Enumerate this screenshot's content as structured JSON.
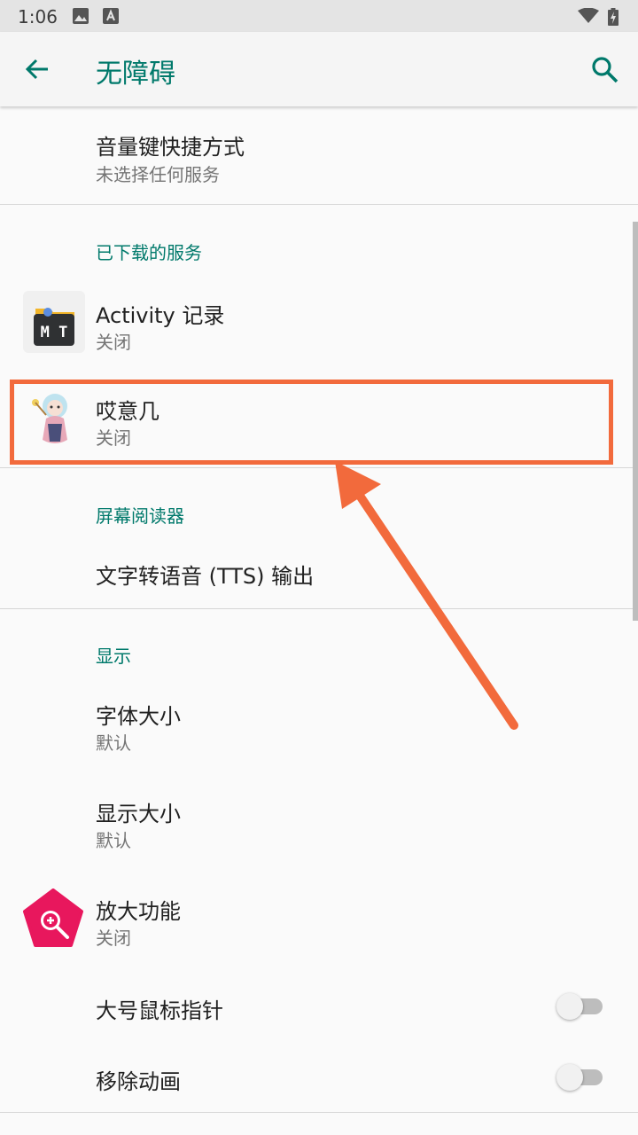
{
  "status_bar": {
    "time": "1:06"
  },
  "app_bar": {
    "title": "无障碍"
  },
  "shortcut": {
    "title": "音量键快捷方式",
    "summary": "未选择任何服务"
  },
  "downloaded_services": {
    "header": "已下载的服务",
    "items": [
      {
        "title": "Activity 记录",
        "summary": "关闭",
        "icon": "mt-manager-icon"
      },
      {
        "title": "哎意几",
        "summary": "关闭",
        "icon": "anime-character-icon"
      }
    ]
  },
  "screen_reader": {
    "header": "屏幕阅读器",
    "tts_title": "文字转语音 (TTS) 输出"
  },
  "display": {
    "header": "显示",
    "font_size": {
      "title": "字体大小",
      "summary": "默认"
    },
    "display_size": {
      "title": "显示大小",
      "summary": "默认"
    },
    "magnification": {
      "title": "放大功能",
      "summary": "关闭"
    },
    "large_pointer": {
      "title": "大号鼠标指针",
      "enabled": false
    },
    "remove_animations": {
      "title": "移除动画",
      "enabled": false
    }
  },
  "colors": {
    "accent": "#00796b",
    "highlight": "#f26a3c"
  }
}
